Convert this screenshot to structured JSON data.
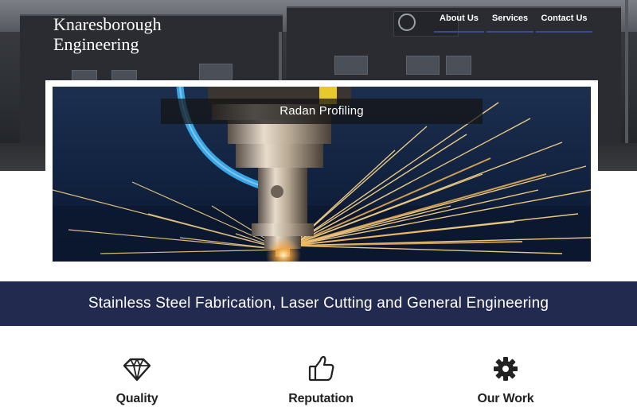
{
  "site": {
    "logo_line1": "Knaresborough",
    "logo_line2": "Engineering"
  },
  "nav": {
    "items": [
      {
        "label": "About Us"
      },
      {
        "label": "Services"
      },
      {
        "label": "Contact Us"
      }
    ],
    "accent_color": "#3c4b8e"
  },
  "slider": {
    "caption": "Radan Profiling",
    "image": "laser-cutting-head-with-sparks"
  },
  "banner": {
    "text": "Stainless Steel Fabrication, Laser Cutting and General Engineering",
    "background": "#222a4f"
  },
  "features": [
    {
      "title": "Quality",
      "icon": "diamond-icon"
    },
    {
      "title": "Reputation",
      "icon": "thumbs-up-icon"
    },
    {
      "title": "Our Work",
      "icon": "gear-icon"
    }
  ],
  "hero": {
    "background_image": "industrial-building-photo"
  }
}
